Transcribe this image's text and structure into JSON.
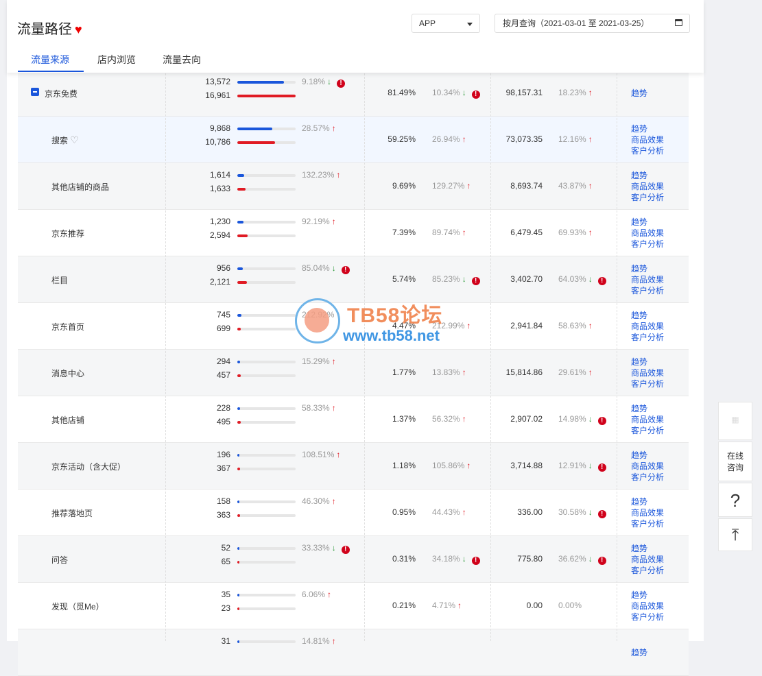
{
  "header": {
    "title": "流量路径",
    "heart": "♥",
    "platform_select": "APP",
    "date_range": "按月查询（2021-03-01 至 2021-03-25）"
  },
  "tabs": [
    {
      "label": "流量来源"
    },
    {
      "label": "店内浏览"
    },
    {
      "label": "流量去向"
    }
  ],
  "link_labels": {
    "trend": "趋势",
    "goods": "商品效果",
    "customer": "客户分析"
  },
  "rows": [
    {
      "name": "京东免费",
      "level": 0,
      "a": "13,572",
      "b": "16,961",
      "a_ratio": 0.8,
      "b_ratio": 1.0,
      "pct1": "9.18%",
      "dir1": "down",
      "warn1": true,
      "pct2": "81.49%",
      "pct3": "10.34%",
      "dir3": "down",
      "warn3": true,
      "val": "98,157.31",
      "pct4": "18.23%",
      "dir4": "up",
      "warn4": false,
      "links": [
        "trend"
      ]
    },
    {
      "name": "搜索",
      "level": 1,
      "heart": "♡",
      "a": "9,868",
      "b": "10,786",
      "a_ratio": 0.6,
      "b_ratio": 0.65,
      "pct1": "28.57%",
      "dir1": "up",
      "warn1": false,
      "pct2": "59.25%",
      "pct3": "26.94%",
      "dir3": "up",
      "warn3": false,
      "val": "73,073.35",
      "pct4": "12.16%",
      "dir4": "up",
      "warn4": false,
      "links": [
        "trend",
        "goods",
        "customer"
      ],
      "highlight": true
    },
    {
      "name": "其他店铺的商品",
      "level": 1,
      "a": "1,614",
      "b": "1,633",
      "a_ratio": 0.12,
      "b_ratio": 0.14,
      "pct1": "132.23%",
      "dir1": "up",
      "warn1": false,
      "pct2": "9.69%",
      "pct3": "129.27%",
      "dir3": "up",
      "warn3": false,
      "val": "8,693.74",
      "pct4": "43.87%",
      "dir4": "up",
      "warn4": false,
      "links": [
        "trend",
        "goods",
        "customer"
      ]
    },
    {
      "name": "京东推荐",
      "level": 1,
      "a": "1,230",
      "b": "2,594",
      "a_ratio": 0.11,
      "b_ratio": 0.18,
      "pct1": "92.19%",
      "dir1": "up",
      "warn1": false,
      "pct2": "7.39%",
      "pct3": "89.74%",
      "dir3": "up",
      "warn3": false,
      "val": "6,479.45",
      "pct4": "69.93%",
      "dir4": "up",
      "warn4": false,
      "links": [
        "trend",
        "goods",
        "customer"
      ]
    },
    {
      "name": "栏目",
      "level": 1,
      "a": "956",
      "b": "2,121",
      "a_ratio": 0.09,
      "b_ratio": 0.16,
      "pct1": "85.04%",
      "dir1": "down",
      "warn1": true,
      "pct2": "5.74%",
      "pct3": "85.23%",
      "dir3": "down",
      "warn3": true,
      "val": "3,402.70",
      "pct4": "64.03%",
      "dir4": "down",
      "warn4": true,
      "links": [
        "trend",
        "goods",
        "customer"
      ]
    },
    {
      "name": "京东首页",
      "level": 1,
      "a": "745",
      "b": "699",
      "a_ratio": 0.07,
      "b_ratio": 0.06,
      "pct1": "212.92%",
      "dir1": "up",
      "warn1": false,
      "pct2": "4.47%",
      "pct3": "212.99%",
      "dir3": "up",
      "warn3": false,
      "val": "2,941.84",
      "pct4": "58.63%",
      "dir4": "up",
      "warn4": false,
      "links": [
        "trend",
        "goods",
        "customer"
      ]
    },
    {
      "name": "消息中心",
      "level": 1,
      "a": "294",
      "b": "457",
      "a_ratio": 0.05,
      "b_ratio": 0.06,
      "pct1": "15.29%",
      "dir1": "up",
      "warn1": false,
      "pct2": "1.77%",
      "pct3": "13.83%",
      "dir3": "up",
      "warn3": false,
      "val": "15,814.86",
      "pct4": "29.61%",
      "dir4": "up",
      "warn4": false,
      "links": [
        "trend",
        "goods",
        "customer"
      ]
    },
    {
      "name": "其他店铺",
      "level": 1,
      "a": "228",
      "b": "495",
      "a_ratio": 0.05,
      "b_ratio": 0.06,
      "pct1": "58.33%",
      "dir1": "up",
      "warn1": false,
      "pct2": "1.37%",
      "pct3": "56.32%",
      "dir3": "up",
      "warn3": false,
      "val": "2,907.02",
      "pct4": "14.98%",
      "dir4": "down",
      "warn4": true,
      "links": [
        "trend",
        "goods",
        "customer"
      ]
    },
    {
      "name": "京东活动（含大促）",
      "level": 1,
      "a": "196",
      "b": "367",
      "a_ratio": 0.04,
      "b_ratio": 0.05,
      "pct1": "108.51%",
      "dir1": "up",
      "warn1": false,
      "pct2": "1.18%",
      "pct3": "105.86%",
      "dir3": "up",
      "warn3": false,
      "val": "3,714.88",
      "pct4": "12.91%",
      "dir4": "down",
      "warn4": true,
      "links": [
        "trend",
        "goods",
        "customer"
      ]
    },
    {
      "name": "推荐落地页",
      "level": 1,
      "a": "158",
      "b": "363",
      "a_ratio": 0.04,
      "b_ratio": 0.05,
      "pct1": "46.30%",
      "dir1": "up",
      "warn1": false,
      "pct2": "0.95%",
      "pct3": "44.43%",
      "dir3": "up",
      "warn3": false,
      "val": "336.00",
      "pct4": "30.58%",
      "dir4": "down",
      "warn4": true,
      "links": [
        "trend",
        "goods",
        "customer"
      ]
    },
    {
      "name": "问答",
      "level": 1,
      "a": "52",
      "b": "65",
      "a_ratio": 0.01,
      "b_ratio": 0.01,
      "pct1": "33.33%",
      "dir1": "down",
      "warn1": true,
      "pct2": "0.31%",
      "pct3": "34.18%",
      "dir3": "down",
      "warn3": true,
      "val": "775.80",
      "pct4": "36.62%",
      "dir4": "down",
      "warn4": true,
      "links": [
        "trend",
        "goods",
        "customer"
      ]
    },
    {
      "name": "发现（觅Me）",
      "level": 1,
      "a": "35",
      "b": "23",
      "a_ratio": 0.01,
      "b_ratio": 0.01,
      "pct1": "6.06%",
      "dir1": "up",
      "warn1": false,
      "pct2": "0.21%",
      "pct3": "4.71%",
      "dir3": "up",
      "warn3": false,
      "val": "0.00",
      "pct4": "0.00%",
      "dir4": "none",
      "warn4": false,
      "links": [
        "trend",
        "goods",
        "customer"
      ]
    },
    {
      "name": "",
      "level": 1,
      "a": "31",
      "b": "",
      "a_ratio": 0.01,
      "b_ratio": 0,
      "pct1": "14.81%",
      "dir1": "up",
      "warn1": false,
      "pct2": "",
      "pct3": "",
      "dir3": "none",
      "warn3": false,
      "val": "",
      "pct4": "",
      "dir4": "none",
      "warn4": false,
      "links": [
        "trend"
      ]
    }
  ],
  "watermark": {
    "title": "TB58论坛",
    "url": "www.tb58.net"
  },
  "side_tools": {
    "consult_line1": "在线",
    "consult_line2": "咨询",
    "help": "?",
    "top": "⤒"
  },
  "colors": {
    "accent": "#1a56db",
    "red": "#e01b24",
    "green": "#2e9b3b",
    "warn": "#d0021b"
  }
}
